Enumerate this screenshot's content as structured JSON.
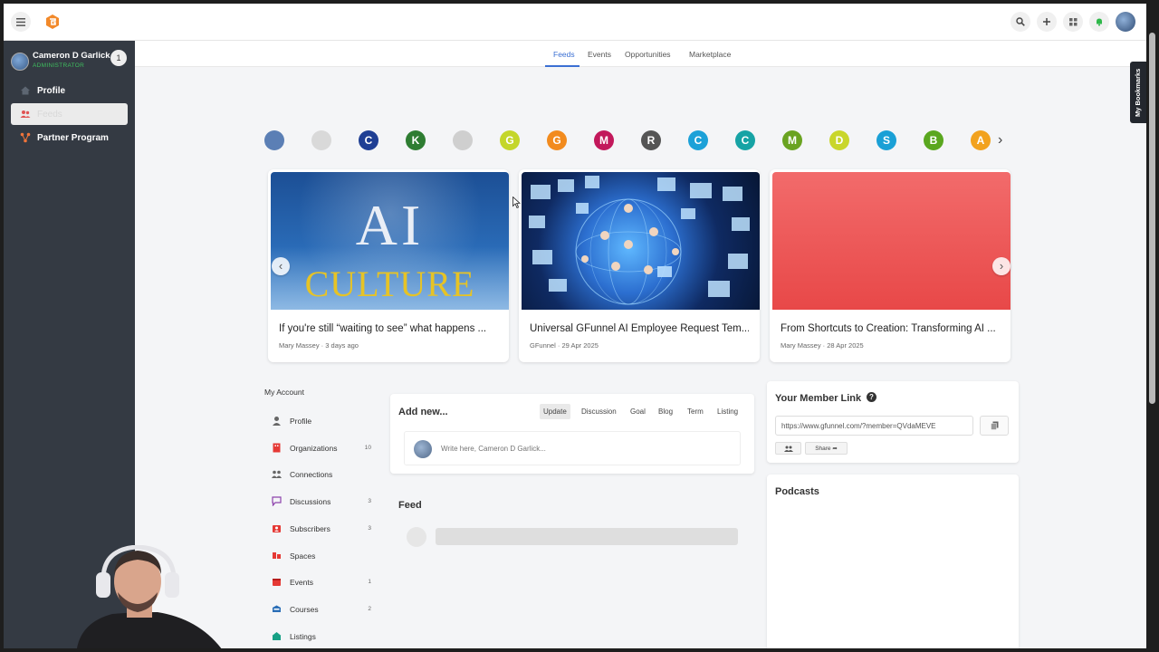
{
  "topbar": {
    "icons": [
      "menu-icon",
      "search-icon",
      "plus-icon",
      "grid-icon",
      "bell-icon"
    ]
  },
  "user": {
    "name": "Cameron D Garlick",
    "role": "ADMINISTRATOR",
    "badge": "1"
  },
  "sidebar": {
    "items": [
      {
        "label": "Profile",
        "icon": "home-icon"
      },
      {
        "label": "Feeds",
        "icon": "users-icon",
        "active": true
      },
      {
        "label": "Partner Program",
        "icon": "share-icon"
      }
    ]
  },
  "subnav": {
    "tabs": [
      "Feeds",
      "Events",
      "Opportunities",
      "Marketplace"
    ],
    "active": "Feeds"
  },
  "stories": [
    {
      "letter": "",
      "color": "#5b7fb5"
    },
    {
      "letter": "",
      "color": "#d9d9d9"
    },
    {
      "letter": "C",
      "color": "#1f3f94"
    },
    {
      "letter": "K",
      "color": "#2e7d32"
    },
    {
      "letter": "",
      "color": "#cfcfcf"
    },
    {
      "letter": "G",
      "color": "#c4d62a"
    },
    {
      "letter": "G",
      "color": "#f28b1e"
    },
    {
      "letter": "M",
      "color": "#c2185b"
    },
    {
      "letter": "R",
      "color": "#555555"
    },
    {
      "letter": "C",
      "color": "#1ca1d8"
    },
    {
      "letter": "C",
      "color": "#17a3a5"
    },
    {
      "letter": "M",
      "color": "#6aa321"
    },
    {
      "letter": "D",
      "color": "#c9d62a"
    },
    {
      "letter": "S",
      "color": "#1aa0d6"
    },
    {
      "letter": "B",
      "color": "#5aa71f"
    },
    {
      "letter": "A",
      "color": "#f2a21e"
    }
  ],
  "cards": [
    {
      "title": "If you're still “waiting to see” what happens ...",
      "author": "Mary Massey",
      "date": "3 days ago",
      "image_text_1": "AI",
      "image_text_2": "CULTURE"
    },
    {
      "title": "Universal GFunnel AI Employee Request Tem...",
      "author": "GFunnel",
      "date": "29 Apr 2025"
    },
    {
      "title": "From Shortcuts to Creation: Transforming AI ...",
      "author": "Mary Massey",
      "date": "28 Apr 2025"
    }
  ],
  "account": {
    "title": "My Account",
    "items": [
      {
        "label": "Profile",
        "count": "",
        "color": "#666666"
      },
      {
        "label": "Organizations",
        "count": "10",
        "color": "#e53935"
      },
      {
        "label": "Connections",
        "count": "",
        "color": "#666666"
      },
      {
        "label": "Discussions",
        "count": "3",
        "color": "#8e44ad"
      },
      {
        "label": "Subscribers",
        "count": "3",
        "color": "#e53935"
      },
      {
        "label": "Spaces",
        "count": "",
        "color": "#e53935"
      },
      {
        "label": "Events",
        "count": "1",
        "color": "#e53935"
      },
      {
        "label": "Courses",
        "count": "2",
        "color": "#2c6fb7"
      },
      {
        "label": "Listings",
        "count": "",
        "color": "#16a085"
      }
    ]
  },
  "addnew": {
    "title": "Add new...",
    "tabs": [
      "Update",
      "Discussion",
      "Goal",
      "Blog",
      "Term",
      "Listing"
    ],
    "active": "Update",
    "placeholder": "Write here, Cameron D Garlick..."
  },
  "feed": {
    "title": "Feed"
  },
  "member_link": {
    "title": "Your Member Link",
    "url": "https://www.gfunnel.com/?member=QVdaMEVE",
    "share_label": "Share"
  },
  "podcasts": {
    "title": "Podcasts"
  },
  "bookmarks": {
    "label": "My Bookmarks"
  },
  "colors": {
    "accent": "#3b6fd3",
    "sidebar": "#343a43",
    "role": "#3fbf5f"
  }
}
